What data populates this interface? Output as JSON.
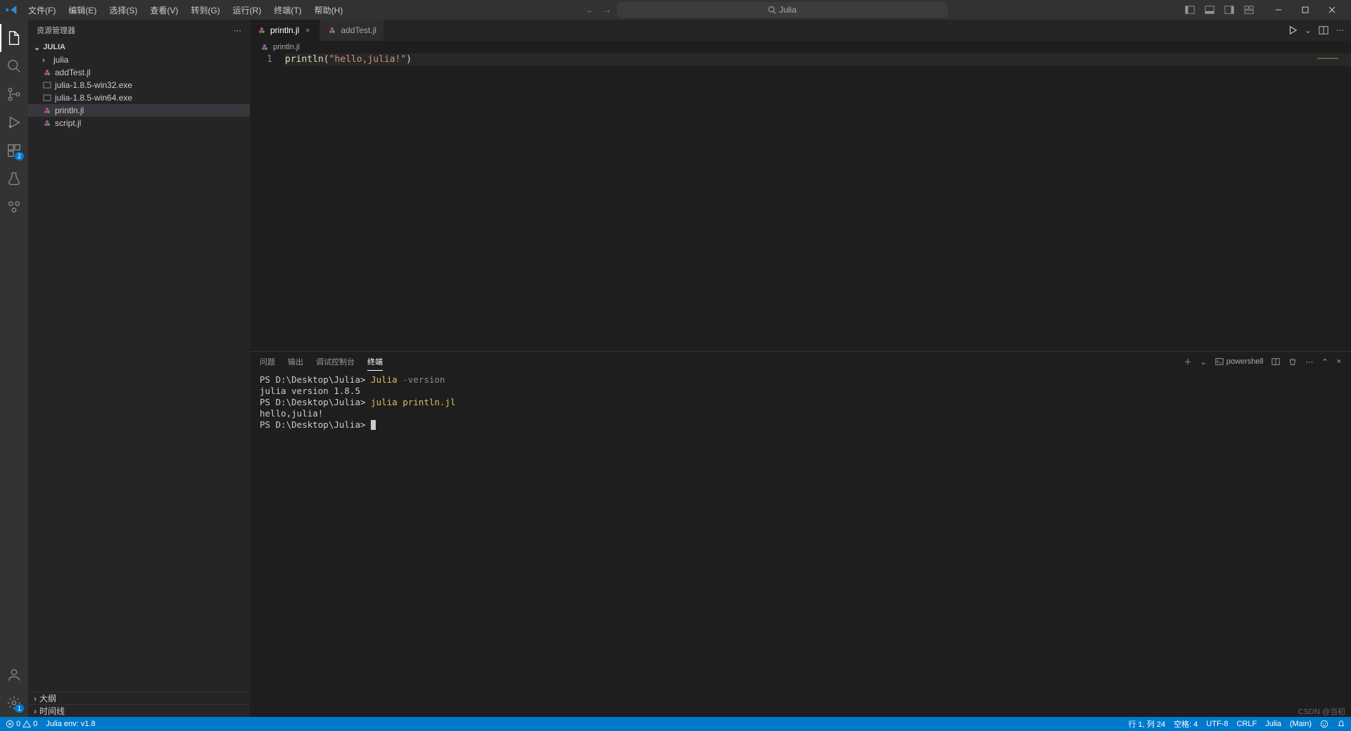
{
  "titlebar": {
    "menu": [
      "文件(F)",
      "编辑(E)",
      "选择(S)",
      "查看(V)",
      "转到(G)",
      "运行(R)",
      "终端(T)",
      "帮助(H)"
    ],
    "search_label": "Julia"
  },
  "sidebar": {
    "title": "资源管理器",
    "section": "JULIA",
    "items": [
      {
        "name": "julia",
        "type": "folder"
      },
      {
        "name": "addTest.jl",
        "type": "julia"
      },
      {
        "name": "julia-1.8.5-win32.exe",
        "type": "exe"
      },
      {
        "name": "julia-1.8.5-win64.exe",
        "type": "exe"
      },
      {
        "name": "println.jl",
        "type": "julia",
        "selected": true
      },
      {
        "name": "script.jl",
        "type": "julia"
      }
    ],
    "outline": "大纲",
    "timeline": "时间线"
  },
  "activity": {
    "ext_badge": "2",
    "gear_badge": "1"
  },
  "tabs": [
    {
      "label": "println.jl",
      "active": true,
      "close": true
    },
    {
      "label": "addTest.jl",
      "active": false,
      "close": false
    }
  ],
  "breadcrumb": "println.jl",
  "code": {
    "line_no": "1",
    "fn": "println",
    "open": "(",
    "str": "\"hello,julia!\"",
    "close": ")"
  },
  "panel": {
    "tabs": [
      "问题",
      "输出",
      "调试控制台",
      "终端"
    ],
    "active_tab": "终端",
    "shell": "powershell",
    "lines": [
      {
        "prompt": "PS D:\\Desktop\\Julia> ",
        "cmd": "Julia",
        "flag": " -version"
      },
      {
        "text": "julia version 1.8.5"
      },
      {
        "prompt": "PS D:\\Desktop\\Julia> ",
        "cmd": "julia",
        "arg": " println.jl"
      },
      {
        "text": "hello,julia!"
      },
      {
        "prompt": "PS D:\\Desktop\\Julia> ",
        "cursor": true
      }
    ]
  },
  "statusbar": {
    "errors": "0",
    "warnings": "0",
    "julia_env": "Julia env: v1.8",
    "line_col": "行 1, 列 24",
    "spaces": "空格: 4",
    "encoding": "UTF-8",
    "eol": "CRLF",
    "lang": "Julia",
    "branch": "(Main)"
  },
  "watermark": "CSDN @当初"
}
